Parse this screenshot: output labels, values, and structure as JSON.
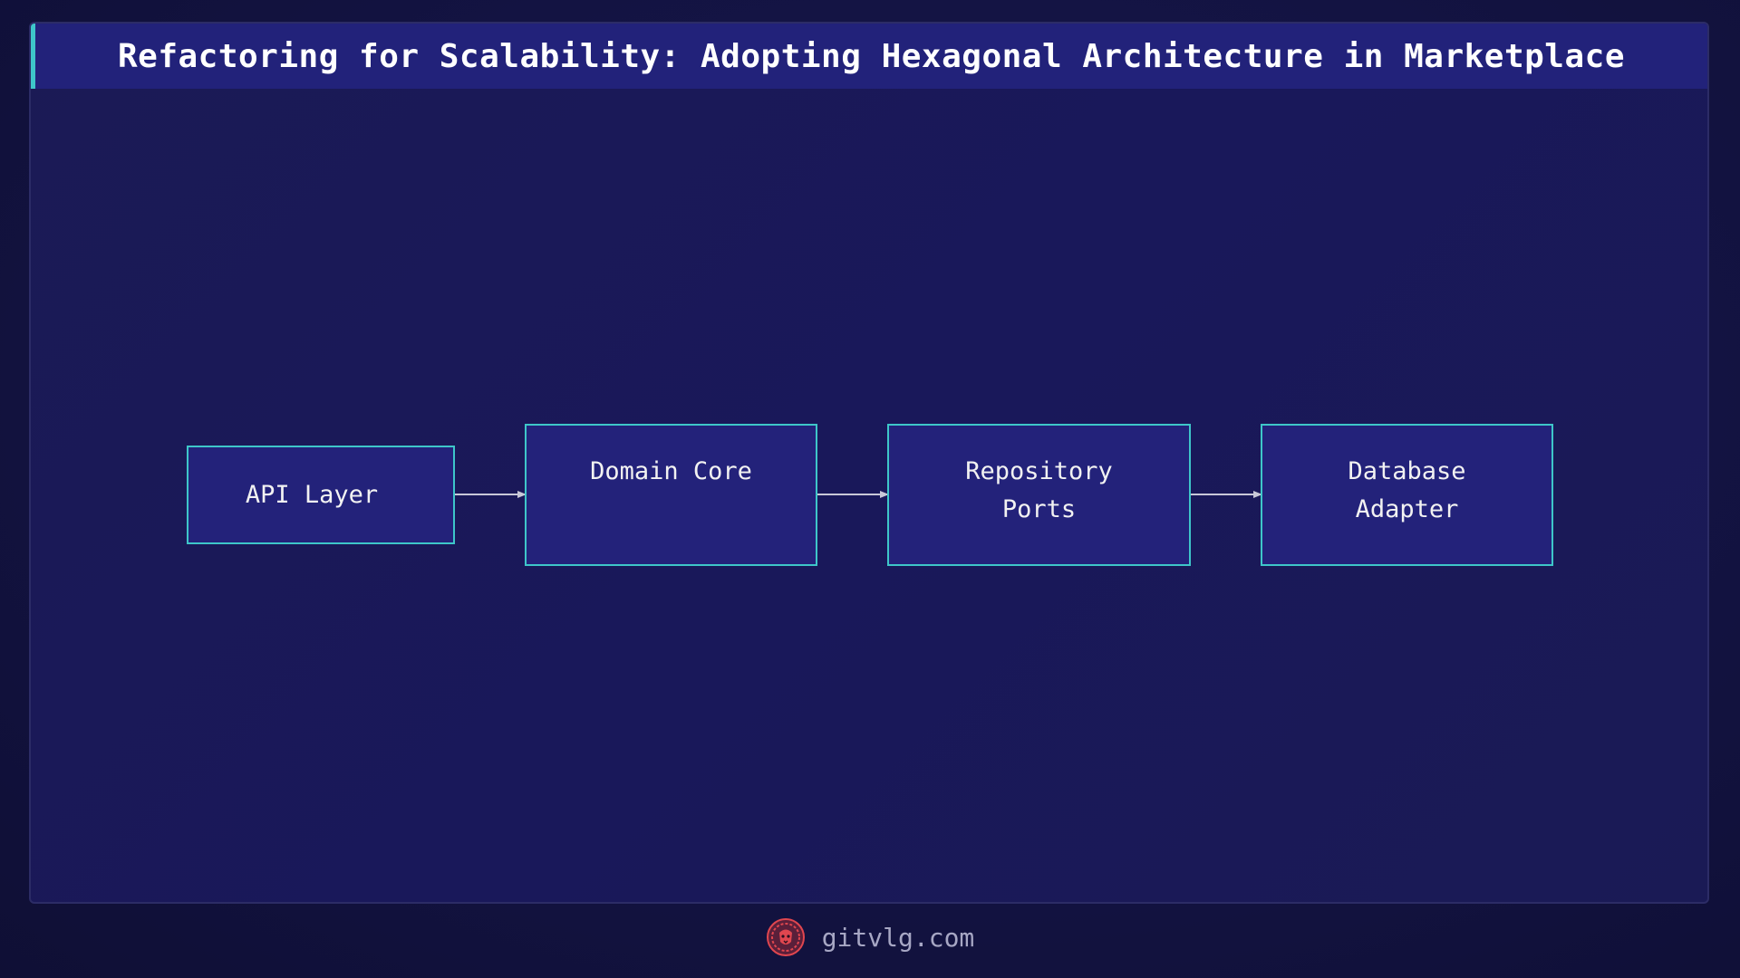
{
  "title": "Refactoring for Scalability: Adopting Hexagonal Architecture in Marketplace",
  "diagram": {
    "nodes": [
      {
        "id": "api",
        "label": "API Layer"
      },
      {
        "id": "domain",
        "label": "Domain Core"
      },
      {
        "id": "repo",
        "label": "Repository\n Ports"
      },
      {
        "id": "db",
        "label": "Database\n Adapter"
      }
    ],
    "edges": [
      {
        "from": "api",
        "to": "domain"
      },
      {
        "from": "domain",
        "to": "repo"
      },
      {
        "from": "repo",
        "to": "db"
      }
    ]
  },
  "footer": {
    "site": "gitvlg.com",
    "logo_icon": "lion-head-icon"
  },
  "colors": {
    "accent": "#3ec6c9",
    "node_fill": "#23227a",
    "arrow": "#c8c8d8",
    "logo": "#e0464f"
  }
}
